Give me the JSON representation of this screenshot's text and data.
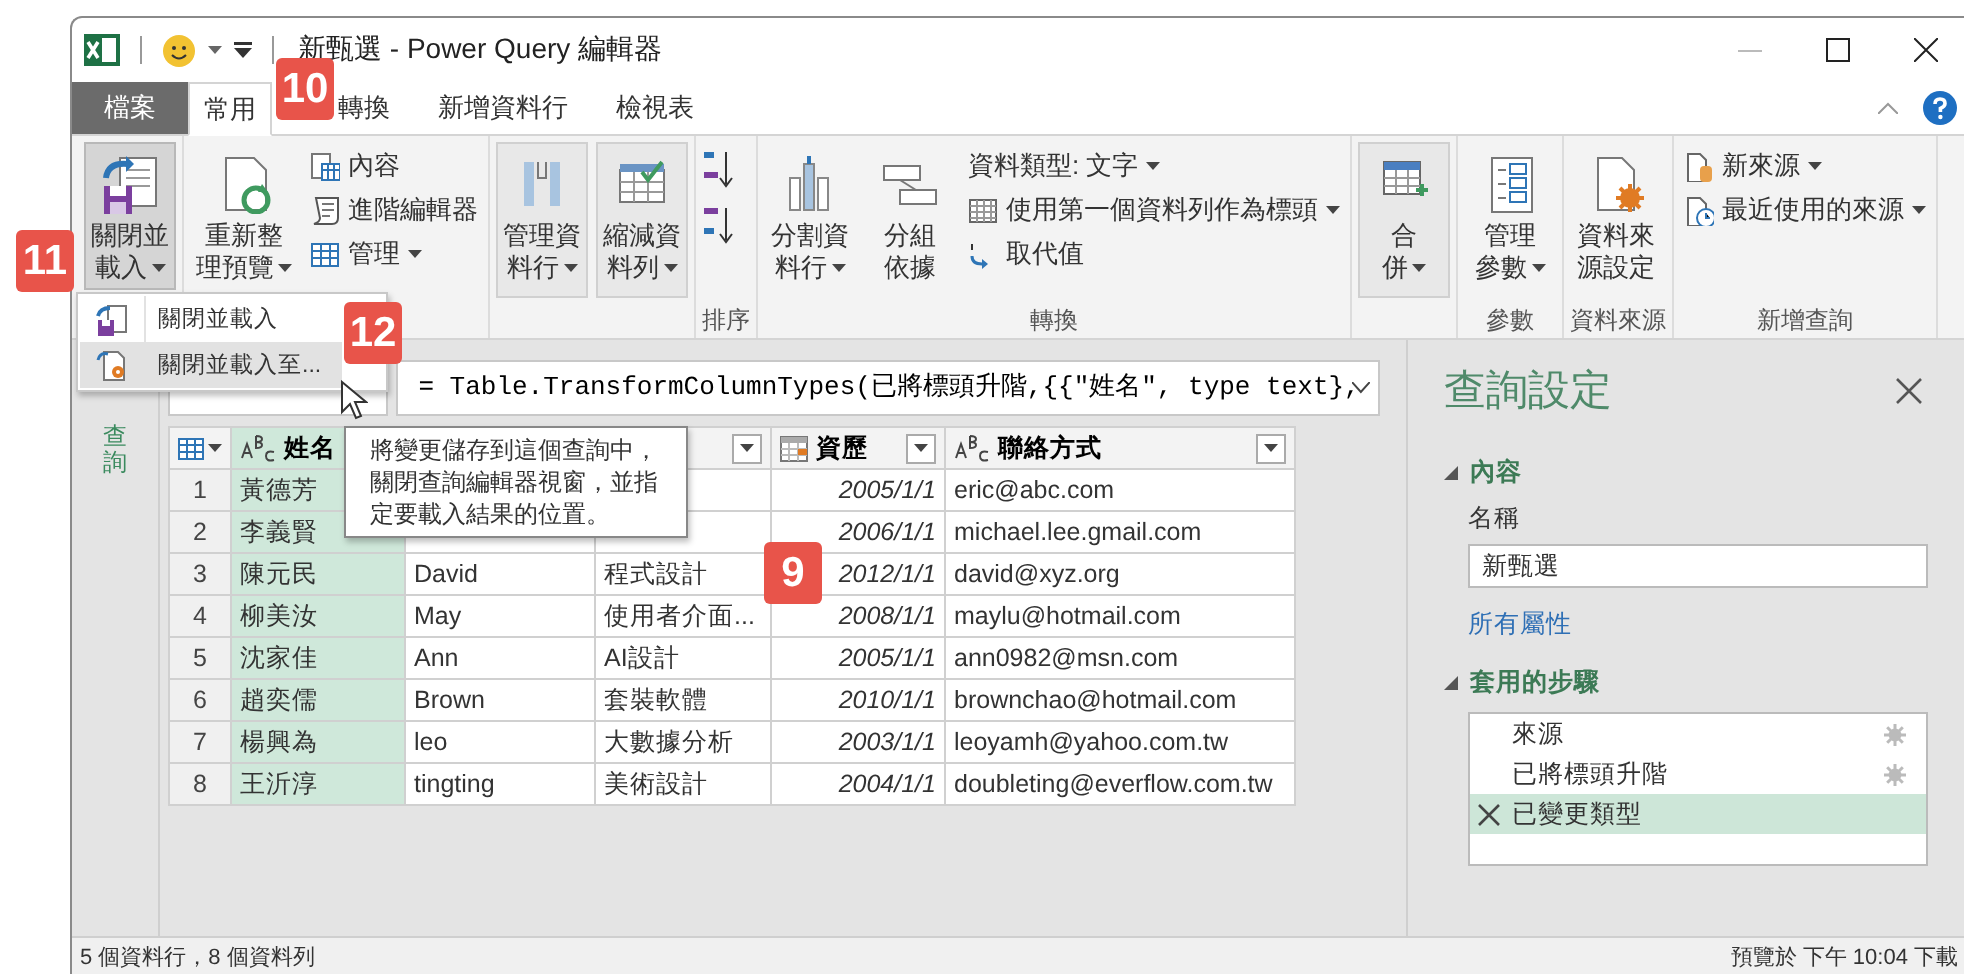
{
  "window": {
    "title": "新甄選 - Power Query 編輯器"
  },
  "tabs": [
    {
      "label": "檔案",
      "kind": "file",
      "selected": false
    },
    {
      "label": "常用",
      "kind": "tab",
      "selected": true
    },
    {
      "label": "轉換",
      "kind": "tab",
      "selected": false
    },
    {
      "label": "新增資料行",
      "kind": "tab",
      "selected": false
    },
    {
      "label": "檢視表",
      "kind": "tab",
      "selected": false
    }
  ],
  "ribbon": {
    "groups": [
      {
        "items": [
          {
            "kind": "large",
            "lines": [
              "關閉並",
              "載入"
            ],
            "dropdown": true,
            "pressed": true
          }
        ]
      },
      {
        "items": [
          {
            "kind": "large",
            "lines": [
              "重新整",
              "理預覽"
            ],
            "dropdown": true,
            "pressed": false
          },
          {
            "kind": "small",
            "label": "內容",
            "dropdown": false,
            "pressed": false
          },
          {
            "kind": "small",
            "label": "進階編輯器",
            "dropdown": false,
            "pressed": false
          },
          {
            "kind": "small",
            "label": "管理",
            "dropdown": true,
            "pressed": false
          }
        ]
      },
      {
        "items": [
          {
            "kind": "boxed",
            "lines": [
              "管理資",
              "料行"
            ],
            "dropdown": true,
            "pressed": false
          },
          {
            "kind": "boxed",
            "lines": [
              "縮減資",
              "料列"
            ],
            "dropdown": true,
            "pressed": false
          }
        ]
      },
      {
        "label": "排序",
        "items": [
          {
            "kind": "sort",
            "pressed": false
          },
          {
            "kind": "sort",
            "pressed": false
          }
        ]
      },
      {
        "label": "轉換",
        "items": [
          {
            "kind": "large",
            "lines": [
              "分割資",
              "料行"
            ],
            "dropdown": true,
            "pressed": false
          },
          {
            "kind": "large",
            "lines": [
              "分組",
              "依據"
            ],
            "dropdown": false,
            "pressed": false
          },
          {
            "kind": "small",
            "label": "資料類型: 文字",
            "dropdown": true,
            "pressed": false
          },
          {
            "kind": "small",
            "label": "使用第一個資料列作為標頭",
            "dropdown": true,
            "pressed": false
          },
          {
            "kind": "small",
            "label": "取代值",
            "dropdown": false,
            "pressed": false
          }
        ]
      },
      {
        "items": [
          {
            "kind": "boxed",
            "lines": [
              "合",
              "併"
            ],
            "dropdown": true,
            "pressed": false
          }
        ]
      },
      {
        "label": "參數",
        "items": [
          {
            "kind": "large",
            "lines": [
              "管理",
              "參數"
            ],
            "dropdown": true,
            "pressed": false
          }
        ]
      },
      {
        "label": "資料來源",
        "items": [
          {
            "kind": "large",
            "lines": [
              "資料來",
              "源設定"
            ],
            "dropdown": false,
            "pressed": false
          }
        ]
      },
      {
        "label": "新增查詢",
        "items": [
          {
            "kind": "small",
            "label": "新來源",
            "dropdown": true,
            "pressed": false
          },
          {
            "kind": "small",
            "label": "最近使用的來源",
            "dropdown": true,
            "pressed": false
          }
        ]
      }
    ]
  },
  "menu": {
    "items": [
      {
        "label": "關閉並載入",
        "selected": false
      },
      {
        "label": "關閉並載入至...",
        "selected": true
      }
    ]
  },
  "tooltip": "將變更儲存到這個查詢中，關閉查詢編輯器視窗，並指定要載入結果的位置。",
  "formula": "= Table.TransformColumnTypes(已將標頭升階,{{\"姓名\", type text},",
  "nav": {
    "label": "查詢"
  },
  "table": {
    "columns": [
      {
        "kind": "text_tail_covered",
        "name": "姓名",
        "selected": true
      },
      {
        "kind": "covered",
        "selected": false
      },
      {
        "kind": "head_covered",
        "selected": false
      },
      {
        "kind": "date",
        "name": "資歷",
        "selected": false
      },
      {
        "kind": "text",
        "name": "聯絡方式",
        "selected": false
      }
    ],
    "rows": [
      {
        "number": "1",
        "cells": [
          "黃德芳",
          null,
          null,
          "2005/1/1",
          "eric@abc.com"
        ]
      },
      {
        "number": "2",
        "cells": [
          "李義賢",
          null,
          null,
          "2006/1/1",
          "michael.lee.gmail.com"
        ]
      },
      {
        "number": "3",
        "cells": [
          "陳元民",
          "David",
          "程式設計",
          "2012/1/1",
          "david@xyz.org"
        ]
      },
      {
        "number": "4",
        "cells": [
          "柳美汝",
          "May",
          "使用者介面...",
          "2008/1/1",
          "maylu@hotmail.com"
        ]
      },
      {
        "number": "5",
        "cells": [
          "沈家佳",
          "Ann",
          "AI設計",
          "2005/1/1",
          "ann0982@msn.com"
        ]
      },
      {
        "number": "6",
        "cells": [
          "趙奕儒",
          "Brown",
          "套裝軟體",
          "2010/1/1",
          "brownchao@hotmail.com"
        ]
      },
      {
        "number": "7",
        "cells": [
          "楊興為",
          "leo",
          "大數據分析",
          "2003/1/1",
          "leoyamh@yahoo.com.tw"
        ]
      },
      {
        "number": "8",
        "cells": [
          "王沂淳",
          "tingting",
          "美術設計",
          "2004/1/1",
          "doubleting@everflow.com.tw"
        ]
      }
    ]
  },
  "settings": {
    "title": "查詢設定",
    "sections": [
      {
        "label": "內容",
        "expanded": true
      },
      {
        "label": "套用的步驟",
        "expanded": true
      }
    ],
    "name_label": "名稱",
    "name_value": "新甄選",
    "link": "所有屬性",
    "steps": [
      {
        "label": "來源",
        "has_settings": true,
        "selected": false
      },
      {
        "label": "已將標頭升階",
        "has_settings": true,
        "selected": false
      },
      {
        "label": "已變更類型",
        "has_settings": false,
        "selected": true
      }
    ]
  },
  "status_bar": {
    "left": "5 個資料行，8 個資料列",
    "right": "預覽於 下午 10:04 下載"
  },
  "badges": [
    {
      "label": "10"
    },
    {
      "label": "11"
    },
    {
      "label": "12"
    },
    {
      "label": "9"
    }
  ]
}
